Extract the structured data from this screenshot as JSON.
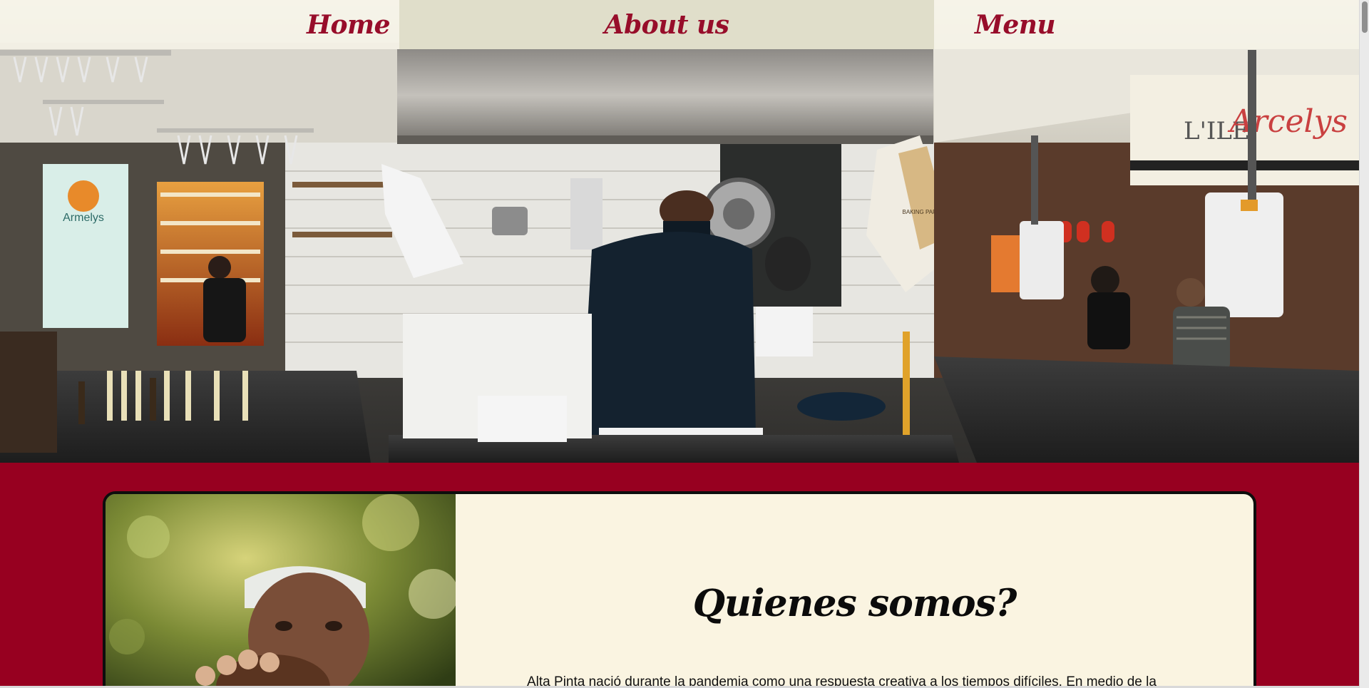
{
  "nav": {
    "items": [
      {
        "label": "Home"
      },
      {
        "label": "About us"
      },
      {
        "label": "Menu"
      }
    ]
  },
  "hero": {
    "sign_armelys": "Armelys",
    "sign_cafe": "L'ILE",
    "sign_script": "Arcelys",
    "paper_text": "BAKING PAPER"
  },
  "about": {
    "title": "Quienes somos?",
    "text": "Alta Pinta nació durante la pandemia como una respuesta creativa a los tiempos difíciles. En medio de la"
  },
  "colors": {
    "brand_red": "#970020",
    "nav_text": "#970d2a",
    "card_bg": "#faf4e1",
    "nav_bg": "#f6f3e8"
  }
}
